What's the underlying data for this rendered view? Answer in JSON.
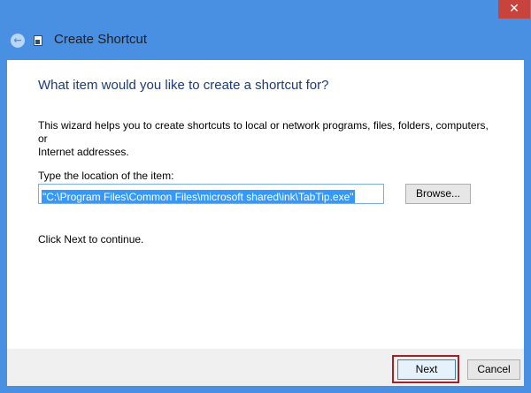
{
  "window": {
    "title": "Create Shortcut",
    "close_glyph": "✕",
    "back_glyph": "←",
    "accent_color": "#4a90e2",
    "close_color": "#c7433b"
  },
  "wizard": {
    "heading": "What item would you like to create a shortcut for?",
    "description_line1": "This wizard helps you to create shortcuts to local or network programs, files, folders, computers, or",
    "description_line2": "Internet addresses.",
    "location_label": "Type the location of the item:",
    "location_value": "\"C:\\Program Files\\Common Files\\microsoft shared\\ink\\TabTip.exe\"",
    "browse_label": "Browse...",
    "continue_text": "Click Next to continue."
  },
  "footer": {
    "next_label": "Next",
    "cancel_label": "Cancel",
    "highlight_color": "#a32027"
  }
}
